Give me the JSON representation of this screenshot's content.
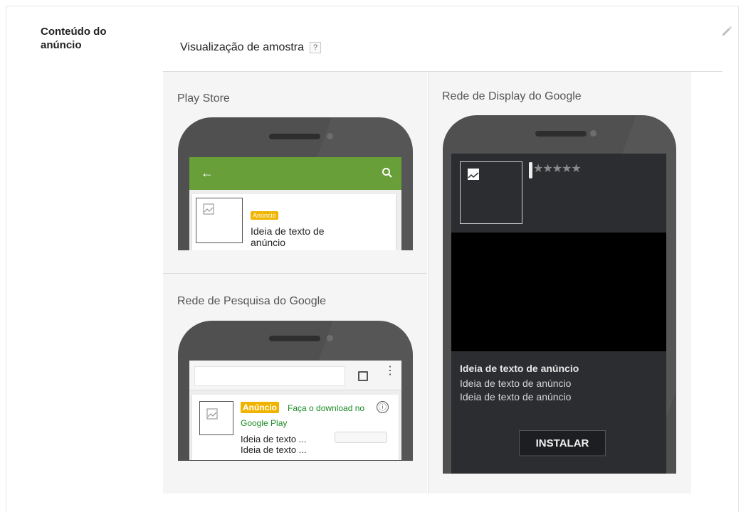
{
  "section": {
    "title": "Conteúdo do anúncio",
    "edit_icon": "pencil-icon"
  },
  "preview": {
    "heading": "Visualização de amostra",
    "help_label": "?"
  },
  "play_store": {
    "label": "Play Store",
    "badge": "Anúncio",
    "ad_text": "Ideia de texto de anúncio",
    "colors": {
      "bar": "#689f38"
    }
  },
  "search": {
    "label": "Rede de Pesquisa do Google",
    "badge": "Anúncio",
    "green_text_1": "Faça o download no",
    "green_text_2": "Google Play",
    "line1": "Ideia de texto ...",
    "line2": "Ideia de texto ...",
    "info_icon": "ⓘ",
    "menu_icon": "⋮"
  },
  "display": {
    "label": "Rede de Display do Google",
    "stars": "★★★★★",
    "title": "Ideia de texto de anúncio",
    "line1": "Ideia de texto de anúncio",
    "line2": "Ideia de texto de anúncio",
    "install_label": "INSTALAR"
  }
}
